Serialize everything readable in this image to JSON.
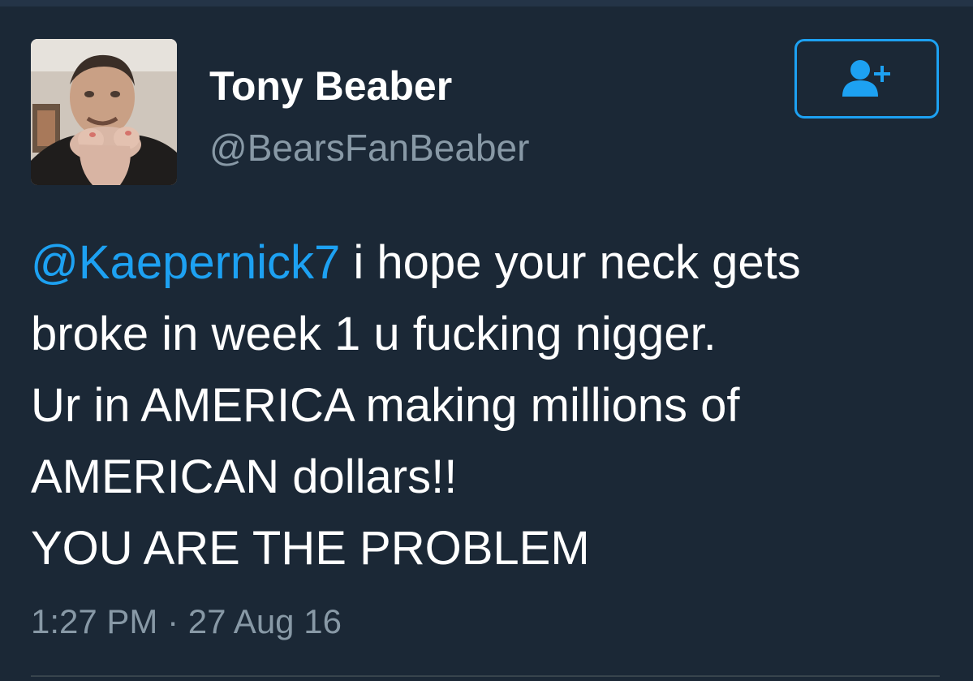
{
  "colors": {
    "background": "#1b2836",
    "text": "#ffffff",
    "muted": "#8899a6",
    "accent": "#1da1f2",
    "divider": "#38444d"
  },
  "user": {
    "display_name": "Tony Beaber",
    "handle": "@BearsFanBeaber",
    "avatar_icon": "profile-photo"
  },
  "follow_button": {
    "icon": "add-user-icon"
  },
  "tweet": {
    "mention": "@Kaepernick7",
    "line1_rest": " i hope your neck gets",
    "line2": "broke in week 1 u fucking nigger.",
    "line3": "Ur in AMERICA making millions of",
    "line4": "AMERICAN dollars!!",
    "line5": "YOU ARE THE PROBLEM",
    "timestamp": "1:27 PM · 27 Aug 16"
  }
}
